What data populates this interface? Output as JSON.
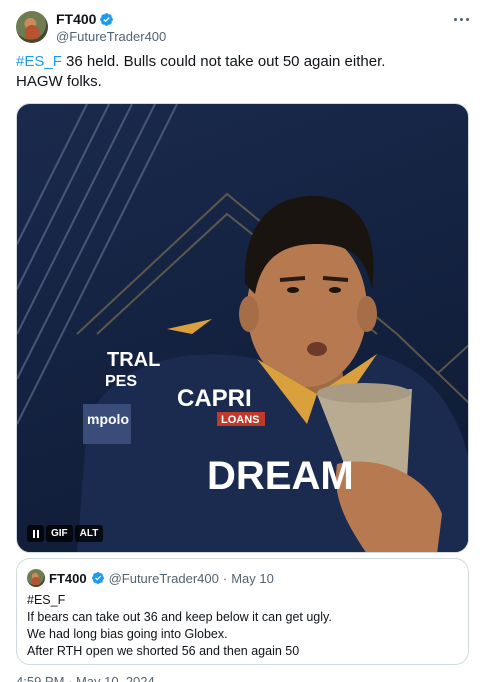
{
  "tweet": {
    "author": {
      "display_name": "FT400",
      "handle": "@FutureTrader400",
      "verified": true
    },
    "text_lines": [
      {
        "hashtag": "#ES_F",
        "rest": " 36 held. Bulls could not take out 50 again either."
      },
      {
        "hashtag": "",
        "rest": "HAGW folks."
      }
    ],
    "media": {
      "type": "gif",
      "badges": {
        "gif": "GIF",
        "alt": "ALT"
      },
      "jersey_texts": {
        "sponsor_main": "CAPRI",
        "sponsor_sub": "LOANS",
        "chest": "DREAM",
        "left_top": "TRAL",
        "left_sub": "PES",
        "sleeve": "mpolo"
      }
    },
    "footer_time": "4:59 PM · May 10, 2024"
  },
  "quoted_tweet": {
    "author": {
      "display_name": "FT400",
      "handle": "@FutureTrader400",
      "verified": true
    },
    "separator": "·",
    "date": "May 10",
    "lines": [
      "#ES_F",
      "If bears can take out 36 and keep below it can get ugly.",
      "We had long bias going into Globex.",
      "After RTH open we shorted 56 and then again 50"
    ]
  },
  "colors": {
    "link": "#1d9bf0",
    "verified": "#1d9bf0",
    "secondary_text": "#536471",
    "jersey": "#1b2b4f",
    "jersey_accent": "#d9a03b"
  }
}
